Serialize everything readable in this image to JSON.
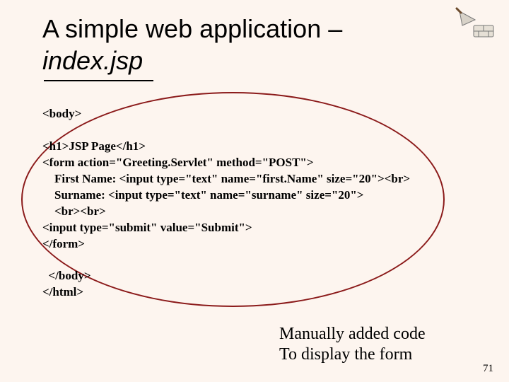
{
  "title": {
    "line1": "A simple web application –",
    "line2_italic": "index.jsp"
  },
  "code": {
    "l0": "<body>",
    "blank1": "",
    "l1": "<h1>JSP Page</h1>",
    "l2": "<form action=\"Greeting.Servlet\" method=\"POST\">",
    "l3": "    First Name: <input type=\"text\" name=\"first.Name\" size=\"20\"><br>",
    "l4": "    Surname: <input type=\"text\" name=\"surname\" size=\"20\">",
    "l5": "    <br><br>",
    "l6": "<input type=\"submit\" value=\"Submit\">",
    "l7": "</form>",
    "blank2": "",
    "l8": "  </body>",
    "l9": "</html>"
  },
  "annotation": {
    "line1": "Manually added code",
    "line2": "To display the form"
  },
  "page_number": "71"
}
